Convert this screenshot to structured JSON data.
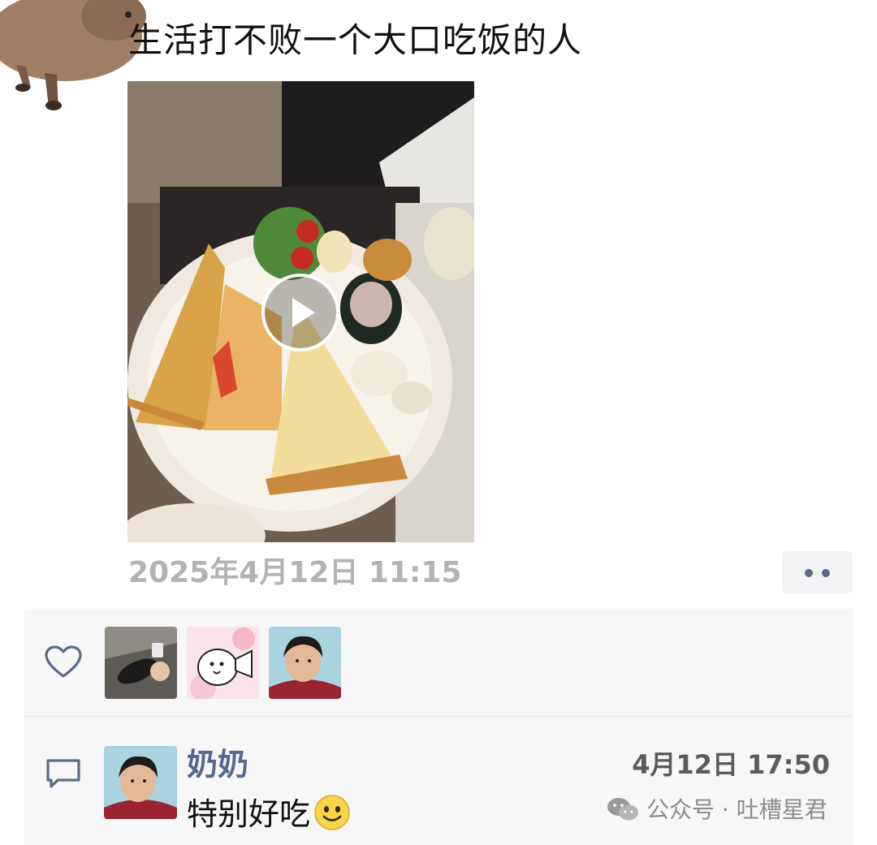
{
  "post": {
    "text": "生活打不败一个大口吃饭的人",
    "time": "2025年4月12日 11:15"
  },
  "video": {
    "icon": "play-icon"
  },
  "more": {
    "icon": "more-dots-icon"
  },
  "likes": {
    "icon": "heart-icon",
    "avatars": [
      "liker-1",
      "liker-2",
      "liker-3"
    ]
  },
  "comment": {
    "icon": "comment-icon",
    "author": "奶奶",
    "time": "4月12日 17:50",
    "text": "特别好吃",
    "emoji": "smile-emoji"
  },
  "watermark": {
    "icon": "wechat-icon",
    "text": "公众号 · 吐槽星君"
  },
  "colors": {
    "name_link": "#56688f",
    "timestamp": "#b3b3b3",
    "panel_bg": "#f7f7f7",
    "icon_stroke": "#5c6b8a"
  }
}
